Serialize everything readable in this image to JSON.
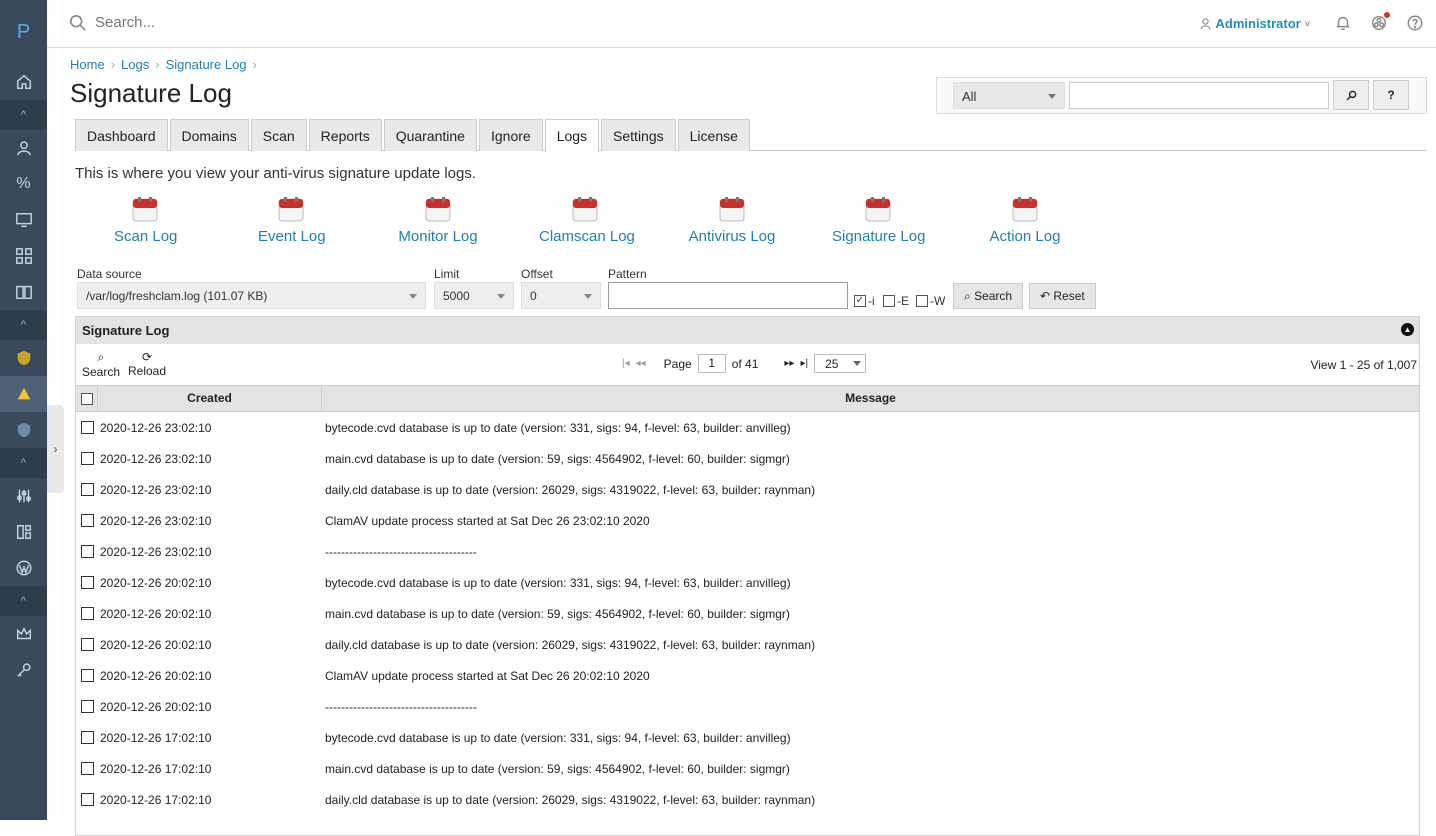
{
  "rail": {
    "logo": "P"
  },
  "topbar": {
    "search_placeholder": "Search...",
    "user": "Administrator"
  },
  "breadcrumb": [
    "Home",
    "Logs",
    "Signature Log"
  ],
  "page_title": "Signature Log",
  "top_search": {
    "scope": "All",
    "help": "?"
  },
  "tabs": [
    "Dashboard",
    "Domains",
    "Scan",
    "Reports",
    "Quarantine",
    "Ignore",
    "Logs",
    "Settings",
    "License"
  ],
  "active_tab": "Logs",
  "description": "This is where you view your anti-virus signature update logs.",
  "log_links": [
    "Scan Log",
    "Event Log",
    "Monitor Log",
    "Clamscan Log",
    "Antivirus Log",
    "Signature Log",
    "Action Log"
  ],
  "filters": {
    "data_source_label": "Data source",
    "data_source_value": "/var/log/freshclam.log (101.07 KB)",
    "limit_label": "Limit",
    "limit_value": "5000",
    "offset_label": "Offset",
    "offset_value": "0",
    "pattern_label": "Pattern",
    "opt_i": "-i",
    "opt_e": "-E",
    "opt_w": "-W",
    "search_btn": "Search",
    "reset_btn": "Reset"
  },
  "grid": {
    "title": "Signature Log",
    "search_label": "Search",
    "reload_label": "Reload",
    "page_label": "Page",
    "page_value": "1",
    "of_pages": "of 41",
    "rows_per_page": "25",
    "view_text": "View 1 - 25 of 1,007",
    "col_created": "Created",
    "col_message": "Message",
    "rows": [
      {
        "created": "2020-12-26 23:02:10",
        "message": "bytecode.cvd database is up to date (version: 331, sigs: 94, f-level: 63, builder: anvilleg)"
      },
      {
        "created": "2020-12-26 23:02:10",
        "message": "main.cvd database is up to date (version: 59, sigs: 4564902, f-level: 60, builder: sigmgr)"
      },
      {
        "created": "2020-12-26 23:02:10",
        "message": "daily.cld database is up to date (version: 26029, sigs: 4319022, f-level: 63, builder: raynman)"
      },
      {
        "created": "2020-12-26 23:02:10",
        "message": "ClamAV update process started at Sat Dec 26 23:02:10 2020"
      },
      {
        "created": "2020-12-26 23:02:10",
        "message": "--------------------------------------"
      },
      {
        "created": "2020-12-26 20:02:10",
        "message": "bytecode.cvd database is up to date (version: 331, sigs: 94, f-level: 63, builder: anvilleg)"
      },
      {
        "created": "2020-12-26 20:02:10",
        "message": "main.cvd database is up to date (version: 59, sigs: 4564902, f-level: 60, builder: sigmgr)"
      },
      {
        "created": "2020-12-26 20:02:10",
        "message": "daily.cld database is up to date (version: 26029, sigs: 4319022, f-level: 63, builder: raynman)"
      },
      {
        "created": "2020-12-26 20:02:10",
        "message": "ClamAV update process started at Sat Dec 26 20:02:10 2020"
      },
      {
        "created": "2020-12-26 20:02:10",
        "message": "--------------------------------------"
      },
      {
        "created": "2020-12-26 17:02:10",
        "message": "bytecode.cvd database is up to date (version: 331, sigs: 94, f-level: 63, builder: anvilleg)"
      },
      {
        "created": "2020-12-26 17:02:10",
        "message": "main.cvd database is up to date (version: 59, sigs: 4564902, f-level: 60, builder: sigmgr)"
      },
      {
        "created": "2020-12-26 17:02:10",
        "message": "daily.cld database is up to date (version: 26029, sigs: 4319022, f-level: 63, builder: raynman)"
      }
    ]
  },
  "colors": {
    "accent": "#1f7fb3",
    "rail": "#3a4a5c"
  }
}
